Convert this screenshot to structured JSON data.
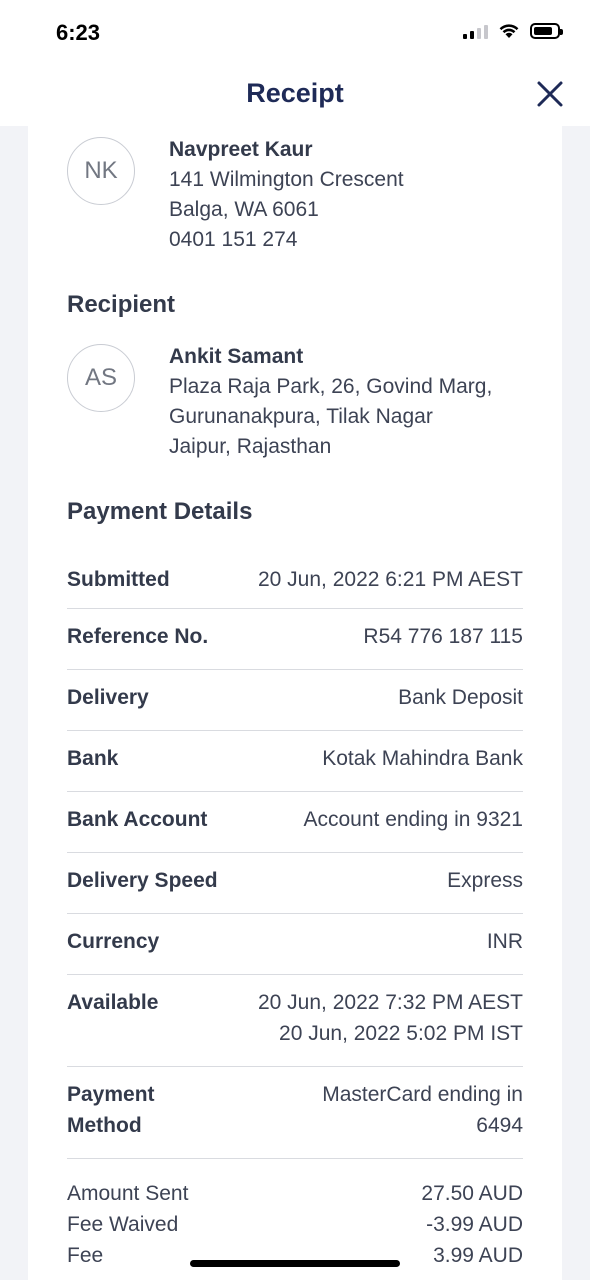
{
  "status_bar": {
    "time": "6:23"
  },
  "header": {
    "title": "Receipt"
  },
  "sender": {
    "initials": "NK",
    "name": "Navpreet Kaur",
    "address_line1": "141 Wilmington Crescent",
    "address_line2": "Balga, WA 6061",
    "phone": "0401 151 274"
  },
  "recipient_section_title": "Recipient",
  "recipient": {
    "initials": "AS",
    "name": "Ankit Samant",
    "address_line1": "Plaza Raja Park, 26, Govind Marg,",
    "address_line2": "Gurunanakpura, Tilak Nagar",
    "address_line3": "Jaipur, Rajasthan"
  },
  "payment_section_title": "Payment Details",
  "payment_details": [
    {
      "label": "Submitted",
      "value": "20 Jun, 2022 6:21 PM AEST"
    },
    {
      "label": "Reference No.",
      "value": "R54 776 187 115"
    },
    {
      "label": "Delivery",
      "value": "Bank Deposit"
    },
    {
      "label": "Bank",
      "value": "Kotak Mahindra Bank"
    },
    {
      "label": "Bank Account",
      "value": "Account ending in 9321"
    },
    {
      "label": "Delivery Speed",
      "value": "Express"
    },
    {
      "label": "Currency",
      "value": "INR"
    },
    {
      "label": "Available",
      "value_line1": "20 Jun, 2022 7:32 PM AEST",
      "value_line2": "20 Jun, 2022 5:02 PM IST"
    },
    {
      "label_line1": "Payment",
      "label_line2": "Method",
      "value_line1": "MasterCard ending in",
      "value_line2": "6494"
    }
  ],
  "amounts": [
    {
      "label": "Amount Sent",
      "value": "27.50 AUD"
    },
    {
      "label": "Fee Waived",
      "value": "-3.99 AUD"
    },
    {
      "label": "Fee",
      "value": "3.99 AUD"
    }
  ]
}
